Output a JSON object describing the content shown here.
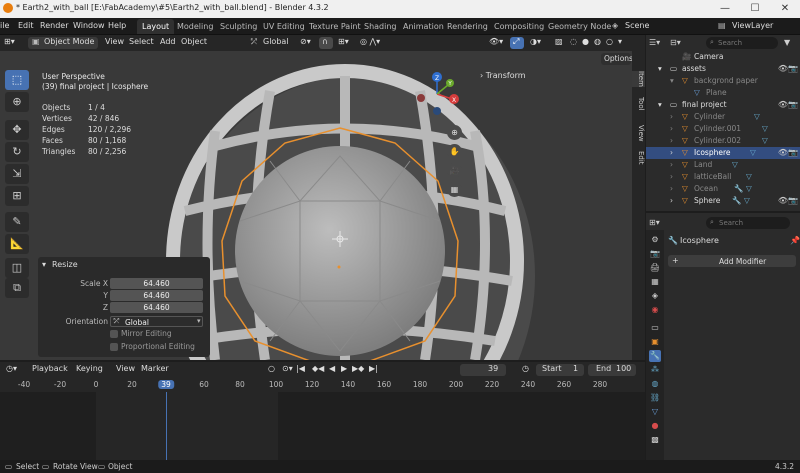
{
  "titlebar": {
    "title": "* Earth2_with_ball [E:\\FabAcademy\\#5\\Earth2_with_ball.blend] - Blender 4.3.2",
    "minimize": "—",
    "maximize": "☐",
    "close": "✕"
  },
  "menu": {
    "items": [
      "ile",
      "Edit",
      "Render",
      "Window",
      "Help"
    ],
    "workspaces": [
      "Layout",
      "Modeling",
      "Sculpting",
      "UV Editing",
      "Texture Paint",
      "Shading",
      "Animation",
      "Rendering",
      "Compositing",
      "Geometry Node"
    ],
    "scene": "Scene",
    "viewlayer": "ViewLayer"
  },
  "viewport_header": {
    "mode": "Object Mode",
    "view": "View",
    "select": "Select",
    "add": "Add",
    "object": "Object",
    "orientation": "Global",
    "options": "Options"
  },
  "viewport": {
    "perspective": "User Perspective",
    "object_info": "(39) final project | Icosphere",
    "stats": [
      {
        "k": "Objects",
        "v": "1 / 4"
      },
      {
        "k": "Vertices",
        "v": "42 / 846"
      },
      {
        "k": "Edges",
        "v": "120 / 2,296"
      },
      {
        "k": "Faces",
        "v": "80 / 1,168"
      },
      {
        "k": "Triangles",
        "v": "80 / 2,256"
      }
    ],
    "transform_panel": "Transform",
    "gizmo": {
      "x": "X",
      "y": "Y",
      "z": "Z"
    }
  },
  "resize": {
    "title": "Resize",
    "scale_x_label": "Scale X",
    "scale_x": "64.460",
    "y_label": "Y",
    "y": "64.460",
    "z_label": "Z",
    "z": "64.460",
    "orientation_label": "Orientation",
    "orientation": "Global",
    "mirror_editing": "Mirror Editing",
    "proportional_editing": "Proportional Editing"
  },
  "side_tabs": [
    "Item",
    "Tool",
    "View",
    "Edit"
  ],
  "outliner": {
    "search_placeholder": "Search",
    "items": [
      {
        "label": "Camera",
        "indent": 1,
        "type": "camera"
      },
      {
        "label": "assets",
        "indent": 0,
        "type": "collection"
      },
      {
        "label": "backgrond paper",
        "indent": 1,
        "type": "mesh"
      },
      {
        "label": "Plane",
        "indent": 2,
        "type": "mesh"
      },
      {
        "label": "final project",
        "indent": 0,
        "type": "collection"
      },
      {
        "label": "Cylinder",
        "indent": 1,
        "type": "mesh"
      },
      {
        "label": "Cylinder.001",
        "indent": 1,
        "type": "mesh"
      },
      {
        "label": "Cylinder.002",
        "indent": 1,
        "type": "mesh"
      },
      {
        "label": "Icosphere",
        "indent": 1,
        "type": "mesh",
        "selected": true
      },
      {
        "label": "Land",
        "indent": 1,
        "type": "mesh"
      },
      {
        "label": "latticeBall",
        "indent": 1,
        "type": "mesh"
      },
      {
        "label": "Ocean",
        "indent": 1,
        "type": "mesh"
      },
      {
        "label": "Sphere",
        "indent": 1,
        "type": "mesh"
      }
    ]
  },
  "properties": {
    "search_placeholder": "Search",
    "object_name": "Icosphere",
    "add_modifier": "Add Modifier"
  },
  "timeline": {
    "menus": [
      "Playback",
      "Keying",
      "View",
      "Marker"
    ],
    "current_frame": "39",
    "start_label": "Start",
    "start": "1",
    "end_label": "End",
    "end": "100",
    "ticks": [
      "-40",
      "-20",
      "0",
      "20",
      "39",
      "60",
      "80",
      "100",
      "120",
      "140",
      "160",
      "180",
      "200",
      "220",
      "240",
      "260",
      "280"
    ]
  },
  "statusbar": {
    "select": "Select",
    "rotate": "Rotate View",
    "object": "Object",
    "version": "4.3.2"
  },
  "colors": {
    "accent": "#4772b3",
    "orange": "#e8902e",
    "selection": "#334d80"
  }
}
